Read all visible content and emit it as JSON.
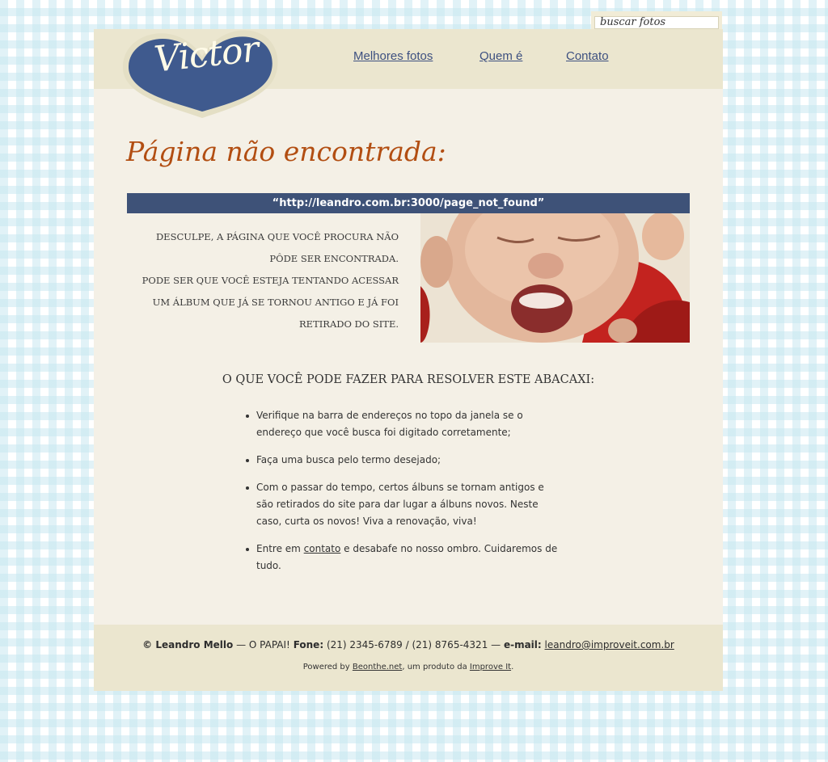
{
  "search": {
    "placeholder": "buscar fotos"
  },
  "logo": {
    "text": "Victor"
  },
  "nav": {
    "items": [
      {
        "label": "Melhores fotos"
      },
      {
        "label": "Quem é"
      },
      {
        "label": "Contato"
      }
    ]
  },
  "main": {
    "title": "Página não encontrada:",
    "url": "“http://leandro.com.br:3000/page_not_found”",
    "apology_lines": [
      "DESCULPE, A PÁGINA QUE VOCÊ PROCURA NÃO",
      "PÔDE SER ENCONTRADA.",
      "PODE SER QUE VOCÊ ESTEJA TENTANDO ACESSAR",
      "UM ÁLBUM QUE JÁ SE TORNOU ANTIGO E JÁ FOI",
      "RETIRADO DO SITE."
    ],
    "subheading": "O QUE VOCÊ PODE FAZER PARA RESOLVER ESTE ABACAXI:",
    "tips": [
      "Verifique na barra de endereços no topo da janela se o endereço que você busca foi digitado corretamente;",
      "Faça uma busca pelo termo desejado;",
      "Com o passar do tempo, certos álbuns se tornam antigos e são retirados do site para dar lugar a álbuns novos. Neste caso, curta os novos! Viva a renovação, viva!"
    ],
    "tip4": {
      "before": "Entre em ",
      "link": "contato",
      "after": " e desabafe no nosso ombro. Cuidaremos de tudo."
    }
  },
  "footer": {
    "copyright": "© Leandro Mello",
    "sep1": " — O PAPAI! ",
    "phone_label": "Fone:",
    "phone": " (21) 2345-6789 / (21) 8765-4321 — ",
    "email_label": "e-mail:",
    "email": "leandro@improveit.com.br",
    "powered_by": "Powered by ",
    "beonthe": "Beonthe.net",
    "produto": ", um produto da ",
    "improve": "Improve It",
    "period": "."
  },
  "colors": {
    "nav_link": "#3d5080",
    "title": "#b24e12",
    "url_bar": "#3e5278",
    "logo_heart": "#3f5a8e"
  }
}
